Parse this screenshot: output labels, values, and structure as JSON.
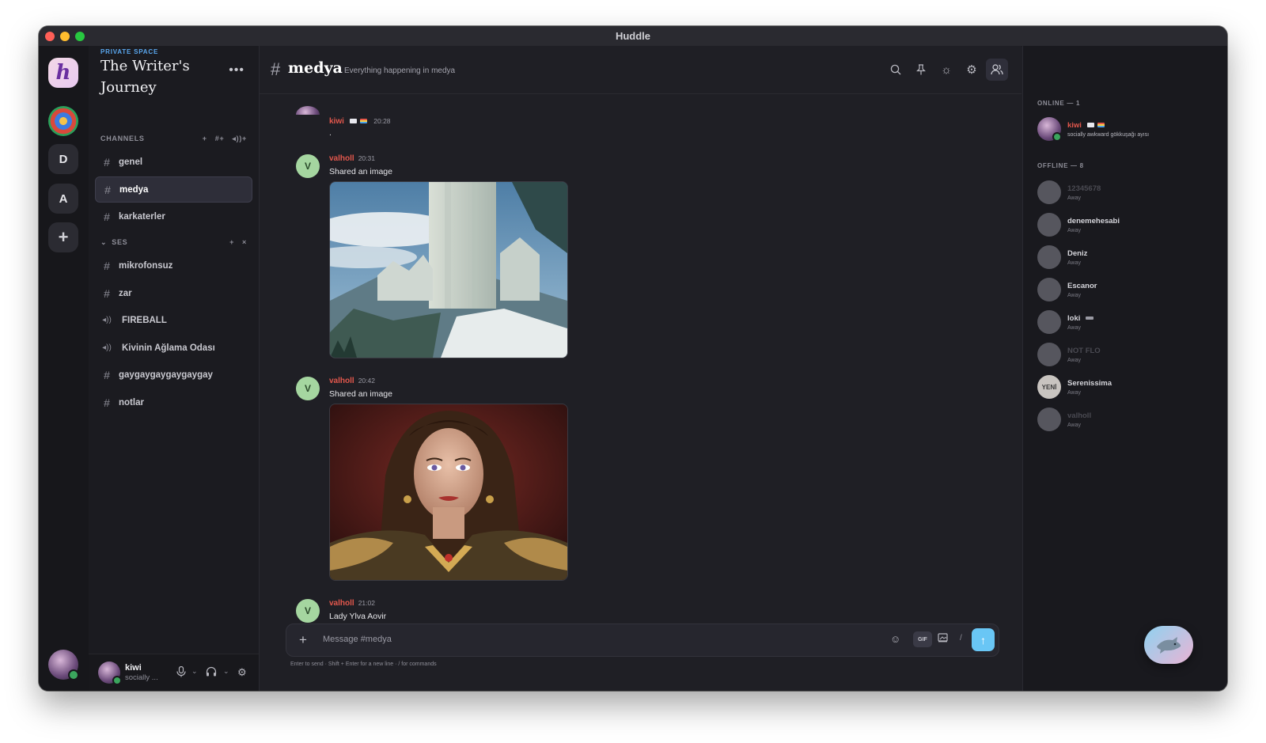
{
  "window": {
    "title": "Huddle"
  },
  "rail": {
    "servers": [
      {
        "label": "h",
        "name": "huddle-logo"
      },
      {
        "label": "",
        "name": "server-emblem"
      },
      {
        "label": "D",
        "name": "server-d"
      },
      {
        "label": "A",
        "name": "server-a"
      },
      {
        "label": "+",
        "name": "add-server"
      }
    ]
  },
  "sidebar": {
    "space_label": "PRIVATE SPACE",
    "space_title": "The Writer's Journey",
    "more_label": "•••",
    "channels_header": "CHANNELS",
    "channels_actions": [
      "+",
      "#+",
      "◂))+"
    ],
    "voice_header": "SES",
    "voice_actions": [
      "+",
      "×"
    ],
    "channels": [
      {
        "name": "genel",
        "type": "text"
      },
      {
        "name": "medya",
        "type": "text",
        "active": true
      },
      {
        "name": "karkaterler",
        "type": "text"
      }
    ],
    "voice_channels": [
      {
        "name": "mikrofonsuz",
        "type": "text"
      },
      {
        "name": "zar",
        "type": "text"
      },
      {
        "name": "FIREBALL",
        "type": "voice"
      },
      {
        "name": "Kivinin Ağlama Odası",
        "type": "voice"
      },
      {
        "name": "gaygaygaygaygaygay",
        "type": "text"
      },
      {
        "name": "notlar",
        "type": "text"
      }
    ],
    "user": {
      "name": "kiwi",
      "status": "socially ..."
    }
  },
  "header": {
    "hash": "#",
    "channel": "medya",
    "topic": "Everything happening in medya",
    "icons": [
      "search-icon",
      "pin-icon",
      "theme-icon",
      "gear-icon",
      "members-icon"
    ]
  },
  "messages": [
    {
      "author": "kiwi",
      "time": "20:28",
      "text": ".",
      "partial": true
    },
    {
      "author": "valholl",
      "initial": "V",
      "time": "20:31",
      "text": "Shared an image",
      "image": "landscape-city"
    },
    {
      "author": "valholl",
      "initial": "V",
      "time": "20:42",
      "text": "Shared an image",
      "image": "portrait-woman"
    },
    {
      "author": "valholl",
      "initial": "V",
      "time": "21:02",
      "text": "Lady Ylva Aovir"
    }
  ],
  "composer": {
    "placeholder": "Message #medya",
    "gif_label": "GIF",
    "slash_label": "/",
    "hint": "Enter to send · Shift + Enter for a new line · / for commands"
  },
  "members": {
    "online_header": "ONLINE — 1",
    "offline_header": "OFFLINE — 8",
    "online": [
      {
        "name": "kiwi",
        "status": "socially awkward gökkuşağı ayısı"
      }
    ],
    "offline": [
      {
        "name": "12345678",
        "status": "Away",
        "dim": true
      },
      {
        "name": "denemehesabi",
        "status": "Away"
      },
      {
        "name": "Deniz",
        "status": "Away"
      },
      {
        "name": "Escanor",
        "status": "Away"
      },
      {
        "name": "loki",
        "status": "Away"
      },
      {
        "name": "NOT FLO",
        "status": "Away",
        "dim": true
      },
      {
        "name": "Serenissima",
        "status": "Away",
        "avatar_text": "YENİ"
      },
      {
        "name": "valholl",
        "status": "Away",
        "dim": true
      }
    ]
  },
  "colors": {
    "accent": "#69c6f5",
    "username_red": "#e2574c",
    "online_green": "#3ba55d"
  }
}
